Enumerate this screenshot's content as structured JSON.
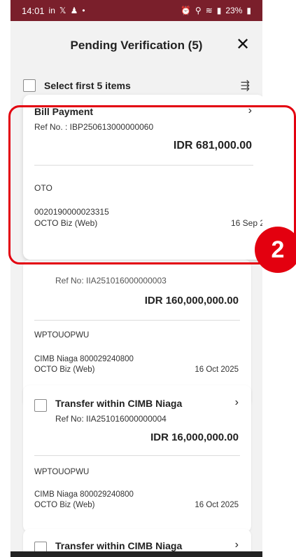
{
  "status_bar": {
    "time": "14:01",
    "left_icons": [
      "linkedin-icon",
      "x-icon",
      "person-icon",
      "dot-icon"
    ],
    "right_text": "23%"
  },
  "header": {
    "title": "Pending Verification (5)",
    "close_glyph": "✕"
  },
  "select_bar": {
    "label": "Select first 5 items",
    "filter_icon": "⇶"
  },
  "highlighted_card": {
    "type": "Bill Payment",
    "ref": "Ref No. : IBP250613000000060",
    "amount": "IDR 681,000.00",
    "remark": "OTO",
    "account": "0020190000023315",
    "channel": "OCTO Biz (Web)",
    "date": "16 Sep 2"
  },
  "cards": [
    {
      "ref_partial": "Ref No: IIA251016000000003",
      "amount": "IDR 160,000,000.00",
      "remark": "WPTOUOPWU",
      "account": "CIMB Niaga 800029240800",
      "channel": "OCTO Biz (Web)",
      "date": "16 Oct 2025"
    },
    {
      "type": "Transfer within CIMB Niaga",
      "ref": "Ref No: IIA251016000000004",
      "amount": "IDR 16,000,000.00",
      "remark": "WPTOUOPWU",
      "account": "CIMB Niaga 800029240800",
      "channel": "OCTO Biz (Web)",
      "date": "16 Oct 2025"
    },
    {
      "type": "Transfer within CIMB Niaga"
    }
  ],
  "annotation": {
    "step_number": "2",
    "color": "#e3000f"
  },
  "chevron": "›"
}
